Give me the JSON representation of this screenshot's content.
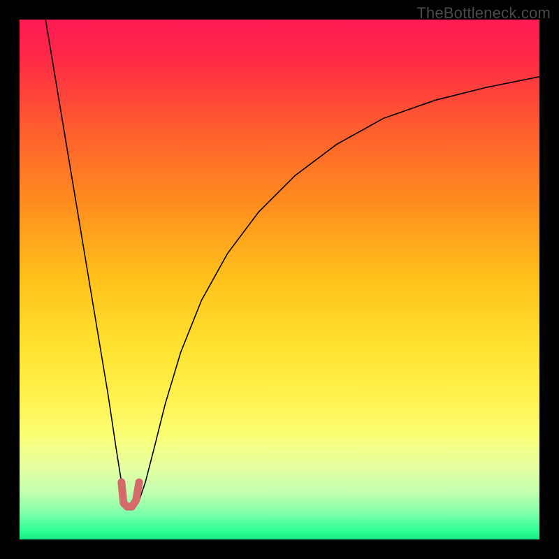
{
  "watermark": "TheBottleneck.com",
  "gradient_stops": [
    {
      "offset": 0.0,
      "color": "#ff1a52"
    },
    {
      "offset": 0.08,
      "color": "#ff2b46"
    },
    {
      "offset": 0.2,
      "color": "#ff5a30"
    },
    {
      "offset": 0.35,
      "color": "#ff8c1e"
    },
    {
      "offset": 0.5,
      "color": "#ffc21a"
    },
    {
      "offset": 0.63,
      "color": "#ffe330"
    },
    {
      "offset": 0.73,
      "color": "#fff250"
    },
    {
      "offset": 0.8,
      "color": "#fbff75"
    },
    {
      "offset": 0.86,
      "color": "#e7ffa0"
    },
    {
      "offset": 0.91,
      "color": "#c2ffb0"
    },
    {
      "offset": 0.95,
      "color": "#7effa8"
    },
    {
      "offset": 0.985,
      "color": "#2bff94"
    },
    {
      "offset": 1.0,
      "color": "#18e884"
    }
  ],
  "chart_data": {
    "type": "line",
    "title": "",
    "xlabel": "",
    "ylabel": "",
    "xlim": [
      0,
      100
    ],
    "ylim": [
      0,
      100
    ],
    "grid": false,
    "series": [
      {
        "name": "bottleneck-curve",
        "stroke": "#000000",
        "stroke_width": 1.6,
        "x": [
          5,
          7,
          9,
          11,
          13,
          15,
          17,
          18.5,
          19.6,
          20.4,
          21.2,
          22.2,
          23.0,
          24.2,
          26,
          28,
          31,
          35,
          40,
          46,
          53,
          61,
          70,
          80,
          90,
          100
        ],
        "y": [
          100,
          88,
          76,
          64,
          52,
          40,
          28,
          18,
          11,
          7,
          6.5,
          6.5,
          7.5,
          11,
          18,
          26,
          36,
          46,
          55,
          63,
          70,
          76,
          81,
          84.5,
          87,
          89
        ]
      },
      {
        "name": "minimum-marker",
        "stroke": "#d46a6a",
        "stroke_width": 11,
        "linecap": "round",
        "x": [
          19.6,
          20.0,
          20.7,
          21.6,
          22.4,
          23.0
        ],
        "y": [
          11.0,
          7.0,
          6.3,
          6.3,
          7.5,
          11.0
        ]
      }
    ]
  }
}
